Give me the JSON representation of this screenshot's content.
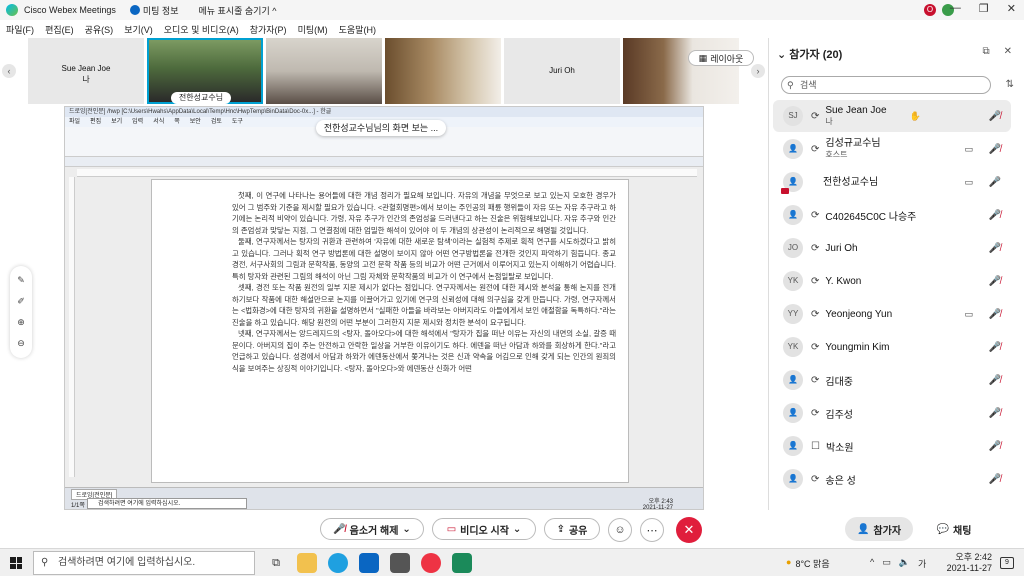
{
  "titlebar": {
    "app_name": "Cisco Webex Meetings",
    "meeting_info": "미팅 정보",
    "hide_menu": "메뉴 표시줄 숨기기 ^",
    "user_initial": "O",
    "window_minimize": "—",
    "window_restore": "❐",
    "window_close": "✕"
  },
  "menubar": [
    "파일(F)",
    "편집(E)",
    "공유(S)",
    "보기(V)",
    "오디오 및 비디오(A)",
    "참가자(P)",
    "미팅(M)",
    "도움말(H)"
  ],
  "strip": {
    "prev": "‹",
    "next": "›",
    "tiles": [
      {
        "name": "Sue Jean Joe",
        "sub": "나"
      },
      {
        "name": "전한성교수님",
        "sub": ""
      },
      {
        "name": "",
        "sub": ""
      },
      {
        "name": "",
        "sub": ""
      },
      {
        "name": "Juri Oh",
        "sub": ""
      },
      {
        "name": "",
        "sub": ""
      }
    ],
    "layout_label": "레이아웃"
  },
  "share": {
    "label": "전한성교수님님의 화면 보는 ...",
    "doc_title": "드로잉[전인문] /hwp [C:\\Users\\Hwahs\\AppData\\Local\\Temp\\Hnc\\HwpTemp\\BinData\\Doc-0x...] - 한글",
    "doc_menu": [
      "파일",
      "편집",
      "보기",
      "입력",
      "서식",
      "쪽",
      "보안",
      "검토",
      "도구"
    ],
    "paragraphs": [
      "첫째, 이 연구에 나타나는 용어들에 대한 개념 정리가 필요해 보입니다. 자유의 개념을 무엇으로 보고 있는지 모호한 경우가 있어 그 범주와 기준을 제시할 필요가 있습니다. <관혈회명편>에서 보이는 주인공의 패륜 행위들이 자유 또는 자유 추구라고 하기에는 논리적 비약이 있습니다. 가령, 자유 추구가 인간의 존엄성을 드러낸다고 하는 진술은 위험해보입니다. 자유 추구와 인간의 존엄성과 맞닿는 지점, 그 연결점에 대한 엄밀한 해석이 있어야 이 두 개념의 상관성이 논리적으로 해명될 것입니다.",
      "둘째, 연구자께서는 탕자의 귀환과 관련하여 '자유에 대한 새로운 탐색'이라는 실험적 주제로 획적 연구를 시도하겠다고 밝히고 있습니다. 그러나 획적 연구 방법론에 대한 설명이 보이지 않아 어떤 연구방법론을 전개한 것인지 파악하기 힘듭니다. 종교 경전, 서구사회의 그림과 문학작품, 동양의 고전 문학 작품 등의 비교가 어떤 근거에서 이루어지고 있는지 이해하기 어렵습니다. 특히 탕자와 관련된 그림의 해석이 아닌 그림 자체와 문학작품의 비교가 이 연구에서 논점일탈로 보입니다.",
      "셋째, 경전 또는 작품 원전의 일부 지문 제시가 없다는 점입니다. 연구자께서는 원전에 대한 제시와 분석을 통해 논지를 전개하기보다 작품에 대한 해설만으로 논지를 이끌어가고 있기에 연구의 신뢰성에 대해 의구심을 갖게 만듭니다. 가령, 연구자께서는 <법화경>에 대한 탕자의 귀환을 설명하면서 \"실패한 아들을 바라보는 아버지라도 아들에게서 보인 애절함을 독특하다.\"라는 진술을 하고 있습니다. 해당 원전의 어떤 부분이 그러한지 지문 제시와 정치한 분석이 요구됩니다.",
      "넷째, 연구자께서는 앙드레지드의 <탕자, 돌아오다>에 대한 해석에서 \"탕자가 집을 떠난 이유는 자신의 내면의 소실, 갈증 때문이다. 아버지의 집이 주는 안전하고 안락한 일상을 거부한 이유이기도 하다. 에덴을 떠난 아담과 하와를 회상하게 한다.\"라고 언급하고 있습니다. 성경에서 아담과 하와가 에덴동산에서 쫓겨나는 것은 신과 약속을 어김으로 인해 갖게 되는 인간의 원죄의식을 보여주는 상징적 이야기입니다. <탕자, 돌아오다>와 에덴동산 신화가 어떤"
    ],
    "status_tab": "드로잉[전인문]",
    "page_info": "1/1쪽   1단   1/1 구역",
    "taskbar_search": "검색하려면 여기에 입력하십시오.",
    "clock_time": "오후 2:43",
    "clock_date": "2021-11-27"
  },
  "controls": {
    "unmute": "음소거 해제",
    "start_video": "비디오 시작",
    "share": "공유",
    "participants": "참가자",
    "chat": "채팅"
  },
  "panel": {
    "title": "참가자 (20)",
    "search_placeholder": "검색",
    "participants": [
      {
        "initials": "SJ",
        "name": "Sue Jean Joe",
        "sub": "나",
        "camera": false,
        "mic": "muted",
        "selected": true
      },
      {
        "initials": "",
        "name": "김성규교수님",
        "sub": "호스트",
        "camera": true,
        "mic": "muted",
        "selected": false
      },
      {
        "initials": "",
        "name": "전한성교수님",
        "sub": "",
        "camera": true,
        "mic": "on",
        "selected": false
      },
      {
        "initials": "",
        "name": "C402645C0C 나승주",
        "sub": "",
        "camera": false,
        "mic": "muted",
        "selected": false
      },
      {
        "initials": "JO",
        "name": "Juri Oh",
        "sub": "",
        "camera": false,
        "mic": "muted",
        "selected": false
      },
      {
        "initials": "YK",
        "name": "Y. Kwon",
        "sub": "",
        "camera": false,
        "mic": "muted",
        "selected": false
      },
      {
        "initials": "YY",
        "name": "Yeonjeong Yun",
        "sub": "",
        "camera": true,
        "mic": "muted",
        "selected": false
      },
      {
        "initials": "YK",
        "name": "Youngmin Kim",
        "sub": "",
        "camera": false,
        "mic": "muted",
        "selected": false
      },
      {
        "initials": "",
        "name": "김대중",
        "sub": "",
        "camera": false,
        "mic": "muted",
        "selected": false
      },
      {
        "initials": "",
        "name": "김주성",
        "sub": "",
        "camera": false,
        "mic": "muted",
        "selected": false
      },
      {
        "initials": "",
        "name": "박소원",
        "sub": "",
        "camera": false,
        "mic": "muted",
        "selected": false
      },
      {
        "initials": "",
        "name": "송은 성",
        "sub": "",
        "camera": false,
        "mic": "muted",
        "selected": false
      }
    ]
  },
  "taskbar": {
    "search_placeholder": "검색하려면 여기에 입력하십시오.",
    "weather": "8°C 맑음",
    "ime": "가",
    "time": "오후 2:42",
    "date": "2021-11-27",
    "notifications": "9"
  },
  "colors": {
    "accent": "#00a0d1",
    "mute_red": "#c8102e",
    "end_red": "#e01e3c",
    "mic_on_green": "#2e9c3c"
  }
}
